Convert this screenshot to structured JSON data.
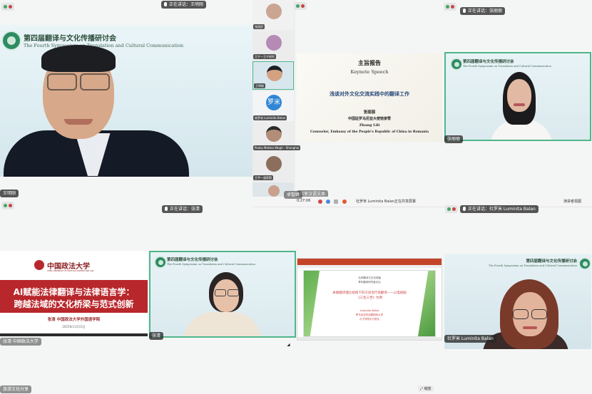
{
  "top_bar": {
    "speaker_tag": "正在讲话：王明刚",
    "icon": "microphone-icon"
  },
  "tile1": {
    "banner_zh": "第四届翻译与文化传播研讨会",
    "banner_en": "The Fourth Symposium on Translation and Cultural Communication",
    "name_tag": "王明刚"
  },
  "sidebar": {
    "participants": [
      {
        "label": "张昌民",
        "avatar_text": ""
      },
      {
        "label": "王宁—王宁研究",
        "avatar_text": ""
      },
      {
        "label": "王明刚",
        "avatar_text": ""
      },
      {
        "label": "宋罗米 Luminita Balan",
        "avatar_text": "罗米"
      },
      {
        "label": "Pooky Matteo Wugh - Shanghai",
        "avatar_text": ""
      },
      {
        "label": "王宇—道家院",
        "avatar_text": ""
      },
      {
        "label": "",
        "avatar_text": ""
      }
    ]
  },
  "tile2": {
    "title_zh": "主旨报告",
    "title_en": "Keynote Speech",
    "topic_zh": "浅谈对外文化交流实践中的翻译工作",
    "speaker_zh": "张丽丽",
    "affiliation_zh": "中国驻罗马尼亚大使馆参赞",
    "speaker_en": "Zhang Lili",
    "affiliation_en": "Counselor, Embassy of the People's Republic of China in Romania",
    "bottom_label": "共享汉语文本"
  },
  "tile3": {
    "speaker_tag": "正在讲话：张丽丽",
    "banner_zh": "第四届翻译与文化传播研讨会",
    "banner_en": "The Fourth Symposium on Translation and Cultural Communication",
    "name_tag": "张丽丽"
  },
  "middle_bar": {
    "left_tag": "卓智峰",
    "share_info": "0:27:06",
    "share_label": "社罗米 Luminita Balan正在共享屏幕",
    "right_label": "演讲者视图"
  },
  "tile4": {
    "speaker_tag": "正在讲话：张清",
    "university": "中国政法大学",
    "university_en": "CHINA UNIVERSITY OF POLITICAL SCIENCE AND LAW",
    "title_line1": "AI赋能法律翻译与法律语言学：",
    "title_line2": "跨越法域的文化桥梁与范式创新",
    "presenter": "张清  中国政法大学外国语学院",
    "date": "2025年11月15日",
    "bottom_label": "张清 中国政法大学"
  },
  "tile5": {
    "speaker_tag": "正在讲话：张清",
    "banner_zh": "第四届翻译与文化传播研讨会",
    "banner_en": "The Fourth Symposium on Translation and Cultural Communication",
    "name_tag": "张清"
  },
  "tile6": {
    "slide_line1": "无声翻译与文化传播",
    "slide_line2": "青年翻译研究者论坛",
    "slide_title": "关联翻译理论视角下的汉语流行语翻译——以电视剧《三生三世》为例",
    "slide_author": "Luminita Balan",
    "slide_affil1": "罗马尼亚布加勒斯特大学",
    "slide_affil2": "孔子学院中方院长",
    "zoom_label": "缩放"
  },
  "tile7": {
    "speaker_tag": "正在讲话：社罗米 Luminita Balan",
    "banner_zh": "第四届翻译与文化传播研讨会",
    "banner_en": "The Fourth Symposium on Translation and Cultural Communication",
    "name_tag": "社罗米 Luminita Balan"
  },
  "bottom_left": {
    "label": "旅游文化分享"
  },
  "colors": {
    "green": "#2e8c63",
    "red_title": "#b8272b",
    "tile_border": "#4fb68a",
    "slide_bg": "#fbeee5"
  }
}
